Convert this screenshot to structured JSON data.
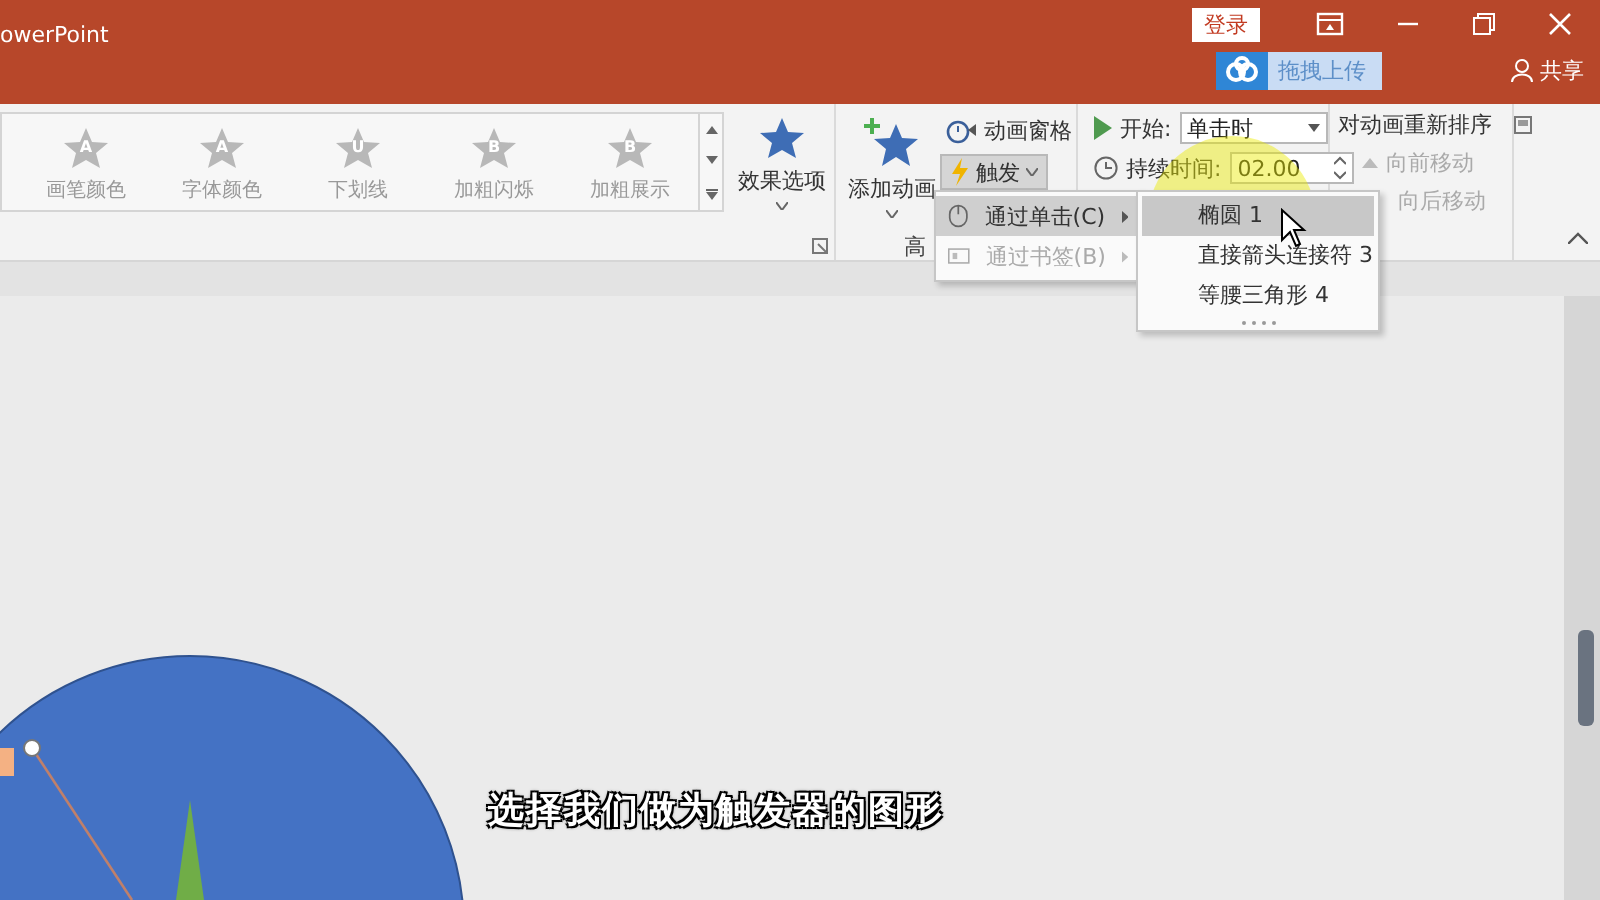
{
  "title_bar": {
    "app_title": "owerPoint",
    "login_button": "登录",
    "upload_badge": "拖拽上传",
    "share_button": "共享"
  },
  "ribbon": {
    "animation_gallery": [
      {
        "glyph": "A",
        "label": "画笔颜色"
      },
      {
        "glyph": "A",
        "label": "字体颜色"
      },
      {
        "glyph": "U",
        "label": "下划线"
      },
      {
        "glyph": "B",
        "label": "加粗闪烁"
      },
      {
        "glyph": "B",
        "label": "加粗展示"
      }
    ],
    "effect_options": "效果选项",
    "add_animation": "添加动画",
    "animation_pane": "动画窗格",
    "trigger_button": "触发",
    "group_label": "高",
    "timing": {
      "start_label": "开始:",
      "start_value": "单击时",
      "duration_label": "持续时间:",
      "duration_value": "02.00"
    },
    "reorder": {
      "title": "对动画重新排序",
      "move_earlier": {
        "label": "向前移动",
        "disabled": true
      },
      "move_later": {
        "label": "向后移动",
        "disabled": true
      }
    }
  },
  "trigger_menu": [
    {
      "label": "通过单击(C)",
      "selected": true,
      "disabled": false
    },
    {
      "label": "通过书签(B)",
      "selected": false,
      "disabled": true
    }
  ],
  "shape_submenu": [
    {
      "label": "椭圆 1",
      "selected": true
    },
    {
      "label": "直接箭头连接符 3",
      "selected": false
    },
    {
      "label": "等腰三角形 4",
      "selected": false
    }
  ],
  "subtitle": "选择我们做为触发器的图形"
}
